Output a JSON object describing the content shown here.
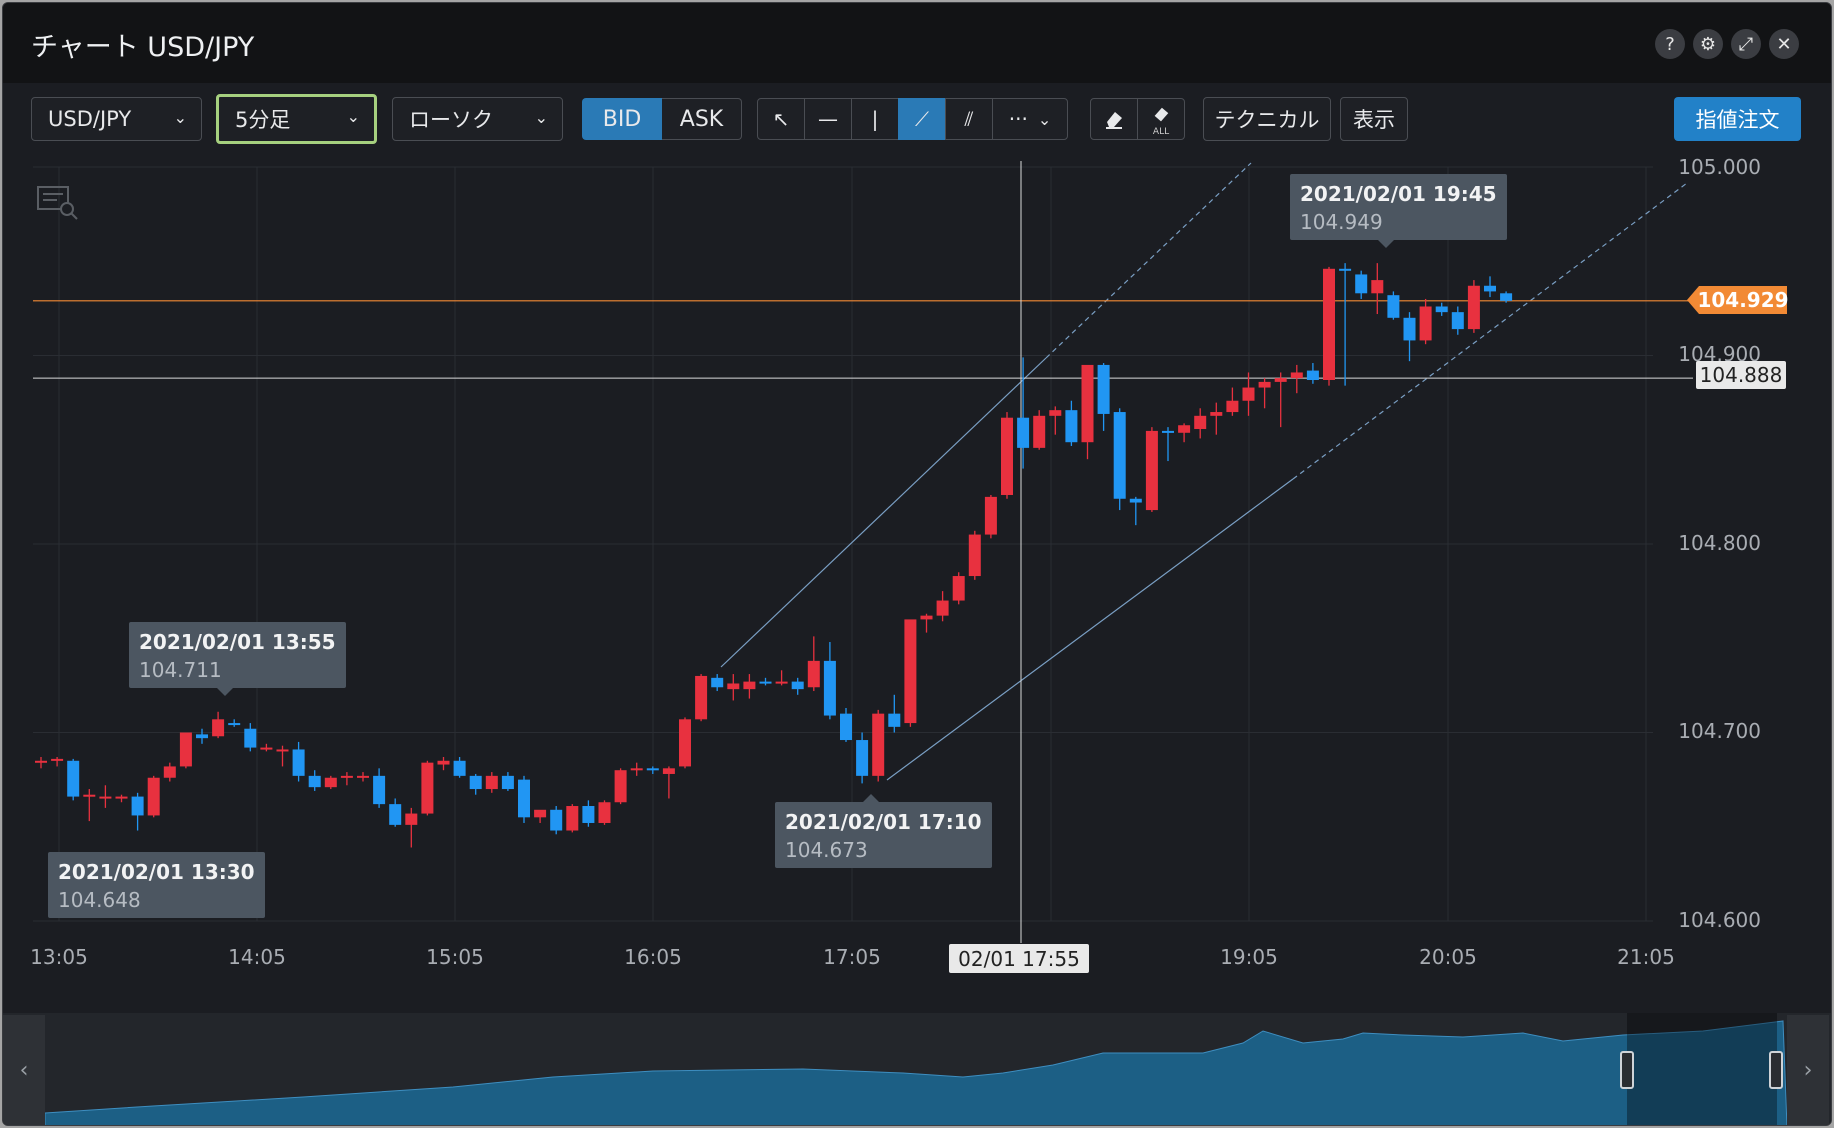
{
  "window": {
    "title": "チャート USD/JPY",
    "controls": {
      "help": "?",
      "settings": "⚙",
      "expand": "⤢",
      "close": "✕"
    }
  },
  "toolbar": {
    "symbol": "USD/JPY",
    "timeframe": "5分足",
    "chart_type": "ローソク",
    "bid_label": "BID",
    "ask_label": "ASK",
    "tools": {
      "cursor": "↖",
      "hline": "—",
      "vline": "|",
      "trendline": "⟋",
      "channel": "⫽",
      "more": "···"
    },
    "erase_all_label": "ALL",
    "technical": "テクニカル",
    "display": "表示",
    "limit_order": "指値注文"
  },
  "chart": {
    "current_price": "104.929",
    "crosshair_price": "104.888",
    "crosshair_time": "02/01 17:55",
    "tooltips": [
      {
        "date": "2021/02/01 13:55",
        "value": "104.711"
      },
      {
        "date": "2021/02/01 13:30",
        "value": "104.648"
      },
      {
        "date": "2021/02/01 17:10",
        "value": "104.673"
      },
      {
        "date": "2021/02/01 19:45",
        "value": "104.949"
      }
    ],
    "y_ticks": [
      "105.000",
      "104.900",
      "104.800",
      "104.700",
      "104.600"
    ],
    "x_ticks": [
      "13:05",
      "14:05",
      "15:05",
      "16:05",
      "17:05",
      "19:05",
      "20:05",
      "21:05"
    ],
    "colors": {
      "up": "#e8313f",
      "down": "#2196f3",
      "bid_active": "#2a7ab6",
      "current_line": "#f28a35"
    }
  },
  "chart_data": {
    "type": "candlestick",
    "timeframe": "5min",
    "ylim": [
      104.6,
      105.0
    ],
    "candles": [
      {
        "o": 104.684,
        "h": 104.687,
        "l": 104.681,
        "c": 104.685
      },
      {
        "o": 104.685,
        "h": 104.687,
        "l": 104.682,
        "c": 104.686
      },
      {
        "o": 104.685,
        "h": 104.686,
        "l": 104.664,
        "c": 104.666
      },
      {
        "o": 104.666,
        "h": 104.67,
        "l": 104.653,
        "c": 104.667
      },
      {
        "o": 104.665,
        "h": 104.672,
        "l": 104.66,
        "c": 104.666
      },
      {
        "o": 104.665,
        "h": 104.667,
        "l": 104.663,
        "c": 104.666
      },
      {
        "o": 104.666,
        "h": 104.668,
        "l": 104.648,
        "c": 104.656
      },
      {
        "o": 104.656,
        "h": 104.677,
        "l": 104.655,
        "c": 104.676
      },
      {
        "o": 104.676,
        "h": 104.684,
        "l": 104.674,
        "c": 104.682
      },
      {
        "o": 104.682,
        "h": 104.7,
        "l": 104.681,
        "c": 104.7
      },
      {
        "o": 104.699,
        "h": 104.702,
        "l": 104.694,
        "c": 104.697
      },
      {
        "o": 104.698,
        "h": 104.711,
        "l": 104.697,
        "c": 104.707
      },
      {
        "o": 104.705,
        "h": 104.707,
        "l": 104.703,
        "c": 104.704
      },
      {
        "o": 104.702,
        "h": 104.705,
        "l": 104.69,
        "c": 104.692
      },
      {
        "o": 104.692,
        "h": 104.694,
        "l": 104.69,
        "c": 104.692
      },
      {
        "o": 104.69,
        "h": 104.693,
        "l": 104.682,
        "c": 104.691
      },
      {
        "o": 104.691,
        "h": 104.695,
        "l": 104.674,
        "c": 104.677
      },
      {
        "o": 104.677,
        "h": 104.68,
        "l": 104.669,
        "c": 104.671
      },
      {
        "o": 104.671,
        "h": 104.677,
        "l": 104.67,
        "c": 104.676
      },
      {
        "o": 104.676,
        "h": 104.679,
        "l": 104.672,
        "c": 104.677
      },
      {
        "o": 104.677,
        "h": 104.679,
        "l": 104.674,
        "c": 104.677
      },
      {
        "o": 104.677,
        "h": 104.681,
        "l": 104.66,
        "c": 104.662
      },
      {
        "o": 104.662,
        "h": 104.665,
        "l": 104.65,
        "c": 104.651
      },
      {
        "o": 104.651,
        "h": 104.66,
        "l": 104.639,
        "c": 104.657
      },
      {
        "o": 104.657,
        "h": 104.685,
        "l": 104.656,
        "c": 104.684
      },
      {
        "o": 104.683,
        "h": 104.687,
        "l": 104.68,
        "c": 104.685
      },
      {
        "o": 104.685,
        "h": 104.687,
        "l": 104.676,
        "c": 104.677
      },
      {
        "o": 104.677,
        "h": 104.678,
        "l": 104.667,
        "c": 104.67
      },
      {
        "o": 104.67,
        "h": 104.679,
        "l": 104.668,
        "c": 104.677
      },
      {
        "o": 104.677,
        "h": 104.679,
        "l": 104.669,
        "c": 104.67
      },
      {
        "o": 104.675,
        "h": 104.677,
        "l": 104.652,
        "c": 104.655
      },
      {
        "o": 104.655,
        "h": 104.658,
        "l": 104.652,
        "c": 104.659
      },
      {
        "o": 104.659,
        "h": 104.661,
        "l": 104.646,
        "c": 104.648
      },
      {
        "o": 104.648,
        "h": 104.662,
        "l": 104.647,
        "c": 104.661
      },
      {
        "o": 104.661,
        "h": 104.664,
        "l": 104.65,
        "c": 104.652
      },
      {
        "o": 104.652,
        "h": 104.664,
        "l": 104.651,
        "c": 104.663
      },
      {
        "o": 104.663,
        "h": 104.681,
        "l": 104.662,
        "c": 104.68
      },
      {
        "o": 104.68,
        "h": 104.684,
        "l": 104.677,
        "c": 104.681
      },
      {
        "o": 104.681,
        "h": 104.682,
        "l": 104.678,
        "c": 104.68
      },
      {
        "o": 104.678,
        "h": 104.682,
        "l": 104.665,
        "c": 104.681
      },
      {
        "o": 104.682,
        "h": 104.708,
        "l": 104.681,
        "c": 104.707
      },
      {
        "o": 104.707,
        "h": 104.731,
        "l": 104.706,
        "c": 104.73
      },
      {
        "o": 104.729,
        "h": 104.731,
        "l": 104.722,
        "c": 104.724
      },
      {
        "o": 104.723,
        "h": 104.731,
        "l": 104.717,
        "c": 104.726
      },
      {
        "o": 104.723,
        "h": 104.731,
        "l": 104.718,
        "c": 104.727
      },
      {
        "o": 104.727,
        "h": 104.729,
        "l": 104.725,
        "c": 104.726
      },
      {
        "o": 104.726,
        "h": 104.733,
        "l": 104.725,
        "c": 104.727
      },
      {
        "o": 104.727,
        "h": 104.729,
        "l": 104.72,
        "c": 104.723
      },
      {
        "o": 104.724,
        "h": 104.751,
        "l": 104.722,
        "c": 104.738
      },
      {
        "o": 104.738,
        "h": 104.748,
        "l": 104.707,
        "c": 104.709
      },
      {
        "o": 104.71,
        "h": 104.713,
        "l": 104.695,
        "c": 104.696
      },
      {
        "o": 104.696,
        "h": 104.7,
        "l": 104.673,
        "c": 104.677
      },
      {
        "o": 104.677,
        "h": 104.712,
        "l": 104.674,
        "c": 104.71
      },
      {
        "o": 104.71,
        "h": 104.72,
        "l": 104.7,
        "c": 104.703
      },
      {
        "o": 104.705,
        "h": 104.72,
        "l": 104.703,
        "c": 104.76
      },
      {
        "o": 104.76,
        "h": 104.763,
        "l": 104.753,
        "c": 104.762
      },
      {
        "o": 104.762,
        "h": 104.775,
        "l": 104.759,
        "c": 104.77
      },
      {
        "o": 104.77,
        "h": 104.785,
        "l": 104.768,
        "c": 104.783
      },
      {
        "o": 104.783,
        "h": 104.807,
        "l": 104.781,
        "c": 104.805
      },
      {
        "o": 104.805,
        "h": 104.826,
        "l": 104.803,
        "c": 104.825
      },
      {
        "o": 104.826,
        "h": 104.87,
        "l": 104.824,
        "c": 104.867
      },
      {
        "o": 104.867,
        "h": 104.899,
        "l": 104.84,
        "c": 104.851
      },
      {
        "o": 104.851,
        "h": 104.871,
        "l": 104.85,
        "c": 104.868
      },
      {
        "o": 104.868,
        "h": 104.873,
        "l": 104.858,
        "c": 104.871
      },
      {
        "o": 104.871,
        "h": 104.876,
        "l": 104.852,
        "c": 104.854
      },
      {
        "o": 104.854,
        "h": 104.88,
        "l": 104.845,
        "c": 104.895
      },
      {
        "o": 104.895,
        "h": 104.896,
        "l": 104.86,
        "c": 104.869
      },
      {
        "o": 104.87,
        "h": 104.872,
        "l": 104.818,
        "c": 104.824
      },
      {
        "o": 104.824,
        "h": 104.825,
        "l": 104.81,
        "c": 104.822
      },
      {
        "o": 104.818,
        "h": 104.862,
        "l": 104.817,
        "c": 104.86
      },
      {
        "o": 104.86,
        "h": 104.862,
        "l": 104.844,
        "c": 104.859
      },
      {
        "o": 104.859,
        "h": 104.864,
        "l": 104.854,
        "c": 104.863
      },
      {
        "o": 104.861,
        "h": 104.872,
        "l": 104.856,
        "c": 104.868
      },
      {
        "o": 104.868,
        "h": 104.875,
        "l": 104.858,
        "c": 104.87
      },
      {
        "o": 104.87,
        "h": 104.883,
        "l": 104.868,
        "c": 104.876
      },
      {
        "o": 104.876,
        "h": 104.891,
        "l": 104.868,
        "c": 104.883
      },
      {
        "o": 104.883,
        "h": 104.888,
        "l": 104.872,
        "c": 104.886
      },
      {
        "o": 104.886,
        "h": 104.891,
        "l": 104.862,
        "c": 104.888
      },
      {
        "o": 104.888,
        "h": 104.895,
        "l": 104.88,
        "c": 104.891
      },
      {
        "o": 104.892,
        "h": 104.896,
        "l": 104.885,
        "c": 104.887
      },
      {
        "o": 104.887,
        "h": 104.947,
        "l": 104.884,
        "c": 104.946
      },
      {
        "o": 104.946,
        "h": 104.949,
        "l": 104.884,
        "c": 104.945
      },
      {
        "o": 104.943,
        "h": 104.945,
        "l": 104.93,
        "c": 104.933
      },
      {
        "o": 104.933,
        "h": 104.949,
        "l": 104.922,
        "c": 104.94
      },
      {
        "o": 104.932,
        "h": 104.934,
        "l": 104.919,
        "c": 104.92
      },
      {
        "o": 104.92,
        "h": 104.923,
        "l": 104.897,
        "c": 104.908
      },
      {
        "o": 104.908,
        "h": 104.93,
        "l": 104.906,
        "c": 104.926
      },
      {
        "o": 104.926,
        "h": 104.928,
        "l": 104.921,
        "c": 104.923
      },
      {
        "o": 104.923,
        "h": 104.926,
        "l": 104.911,
        "c": 104.914
      },
      {
        "o": 104.914,
        "h": 104.94,
        "l": 104.912,
        "c": 104.937
      },
      {
        "o": 104.937,
        "h": 104.942,
        "l": 104.931,
        "c": 104.934
      },
      {
        "o": 104.933,
        "h": 104.934,
        "l": 104.928,
        "c": 104.929
      }
    ],
    "x_ticks": [
      "13:05",
      "14:05",
      "15:05",
      "16:05",
      "17:05",
      "19:05",
      "20:05",
      "21:05"
    ],
    "y_ticks": [
      105.0,
      104.9,
      104.8,
      104.7,
      104.6
    ],
    "annotations": [
      {
        "time": "2021/02/01 13:55",
        "value": 104.711
      },
      {
        "time": "2021/02/01 13:30",
        "value": 104.648
      },
      {
        "time": "2021/02/01 17:10",
        "value": 104.673
      },
      {
        "time": "2021/02/01 19:45",
        "value": 104.949
      }
    ],
    "current_price": 104.929,
    "crosshair": {
      "time": "02/01 17:55",
      "price": 104.888
    },
    "grid": true
  }
}
